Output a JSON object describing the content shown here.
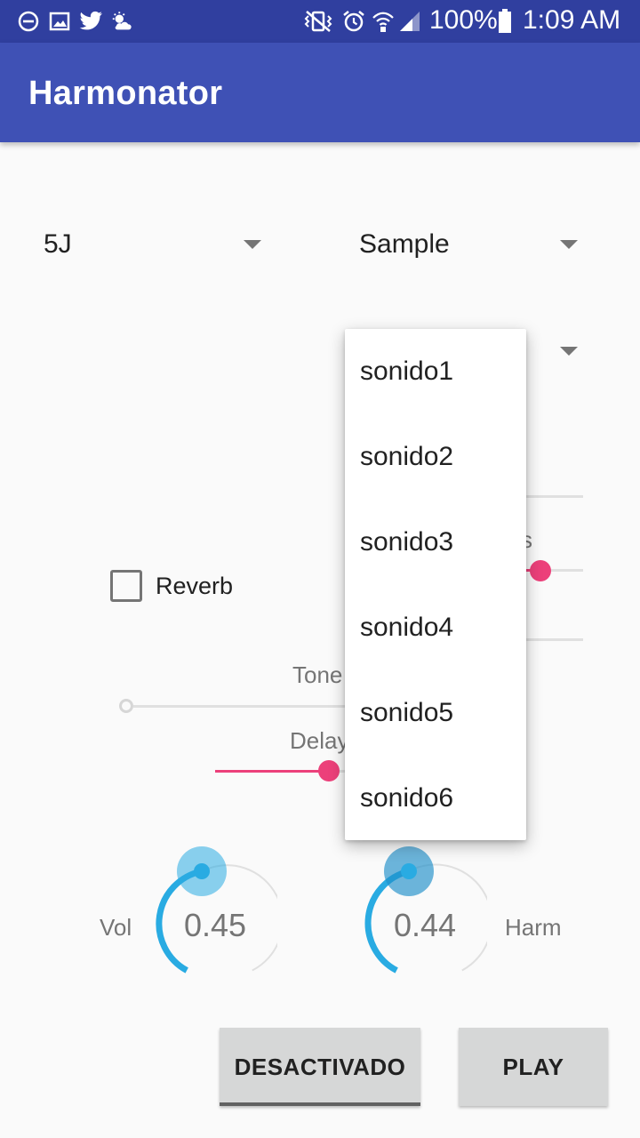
{
  "status_bar": {
    "icons": [
      "do-not-disturb-icon",
      "image-icon",
      "twitter-icon",
      "partly-cloudy-icon",
      "vibrate-mute-icon",
      "alarm-icon",
      "wifi-icon",
      "signal-icon",
      "battery-icon"
    ],
    "battery_percent": "100%",
    "time": "1:09 AM"
  },
  "app_bar": {
    "title": "Harmonator"
  },
  "spinners": {
    "key": {
      "value": "5J"
    },
    "source": {
      "value": "Sample"
    }
  },
  "reverb": {
    "label": "Reverb",
    "checked": false
  },
  "sliders": {
    "tone_label": "Tone",
    "delay_label": "Delay",
    "partial_label": "s"
  },
  "knobs": {
    "vol": {
      "label": "Vol",
      "value": "0.45"
    },
    "harm": {
      "label": "Harm",
      "value": "0.44"
    }
  },
  "buttons": {
    "desactivado": "DESACTIVADO",
    "play": "PLAY"
  },
  "dropdown": {
    "items": [
      "sonido1",
      "sonido2",
      "sonido3",
      "sonido4",
      "sonido5",
      "sonido6"
    ]
  },
  "colors": {
    "status_bar": "#303f9f",
    "app_bar": "#3f51b5",
    "accent": "#ec407a",
    "knob": "#29abe2"
  }
}
